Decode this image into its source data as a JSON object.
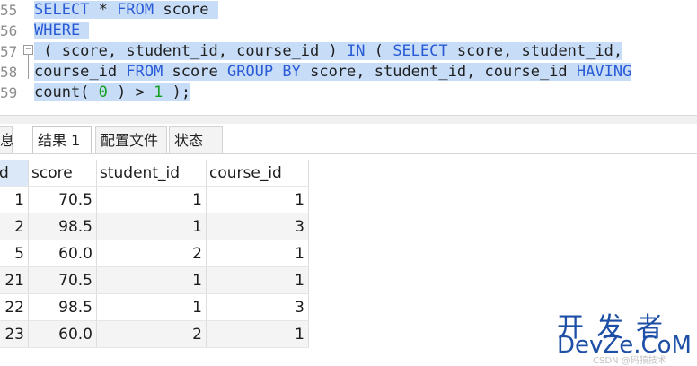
{
  "editor": {
    "lines": [
      {
        "num": "55",
        "segments": [
          {
            "t": "SELECT",
            "c": "kw"
          },
          {
            "t": " * ",
            "c": ""
          },
          {
            "t": "FROM",
            "c": "kw"
          },
          {
            "t": " score ",
            "c": ""
          }
        ]
      },
      {
        "num": "56",
        "segments": [
          {
            "t": "WHERE",
            "c": "kw"
          },
          {
            "t": " ",
            "c": ""
          }
        ]
      },
      {
        "num": "57",
        "segments": [
          {
            "t": " ( score, student_id, course_id ) ",
            "c": ""
          },
          {
            "t": "IN",
            "c": "kw"
          },
          {
            "t": " ( ",
            "c": ""
          },
          {
            "t": "SELECT",
            "c": "kw"
          },
          {
            "t": " score, student_id,",
            "c": ""
          }
        ]
      },
      {
        "num": "58",
        "segments": [
          {
            "t": "course_id ",
            "c": ""
          },
          {
            "t": "FROM",
            "c": "kw"
          },
          {
            "t": " score ",
            "c": ""
          },
          {
            "t": "GROUP BY",
            "c": "kw"
          },
          {
            "t": " score, student_id, course_id ",
            "c": ""
          },
          {
            "t": "HAVING",
            "c": "kw"
          }
        ]
      },
      {
        "num": "59",
        "segments": [
          {
            "t": "count( ",
            "c": ""
          },
          {
            "t": "0",
            "c": "num"
          },
          {
            "t": " ) > ",
            "c": ""
          },
          {
            "t": "1",
            "c": "num"
          },
          {
            "t": " );",
            "c": ""
          }
        ]
      }
    ]
  },
  "tabs": [
    {
      "label": "息",
      "active": false
    },
    {
      "label": "结果 1",
      "active": true
    },
    {
      "label": "配置文件",
      "active": false
    },
    {
      "label": "状态",
      "active": false
    }
  ],
  "table": {
    "columns": [
      "d",
      "score",
      "student_id",
      "course_id"
    ],
    "rows": [
      [
        "1",
        "70.5",
        "1",
        "1"
      ],
      [
        "2",
        "98.5",
        "1",
        "3"
      ],
      [
        "5",
        "60.0",
        "2",
        "1"
      ],
      [
        "21",
        "70.5",
        "1",
        "1"
      ],
      [
        "22",
        "98.5",
        "1",
        "3"
      ],
      [
        "23",
        "60.0",
        "2",
        "1"
      ]
    ]
  },
  "watermark": {
    "cn": "开发者",
    "en": "DevZe.CoM",
    "sub": "CSDN @码猿技术"
  },
  "colors": {
    "keyword": "#2a5bd7",
    "number": "#14a01e",
    "selection": "#c7dcf7",
    "watermark": "#1e4fa6"
  }
}
